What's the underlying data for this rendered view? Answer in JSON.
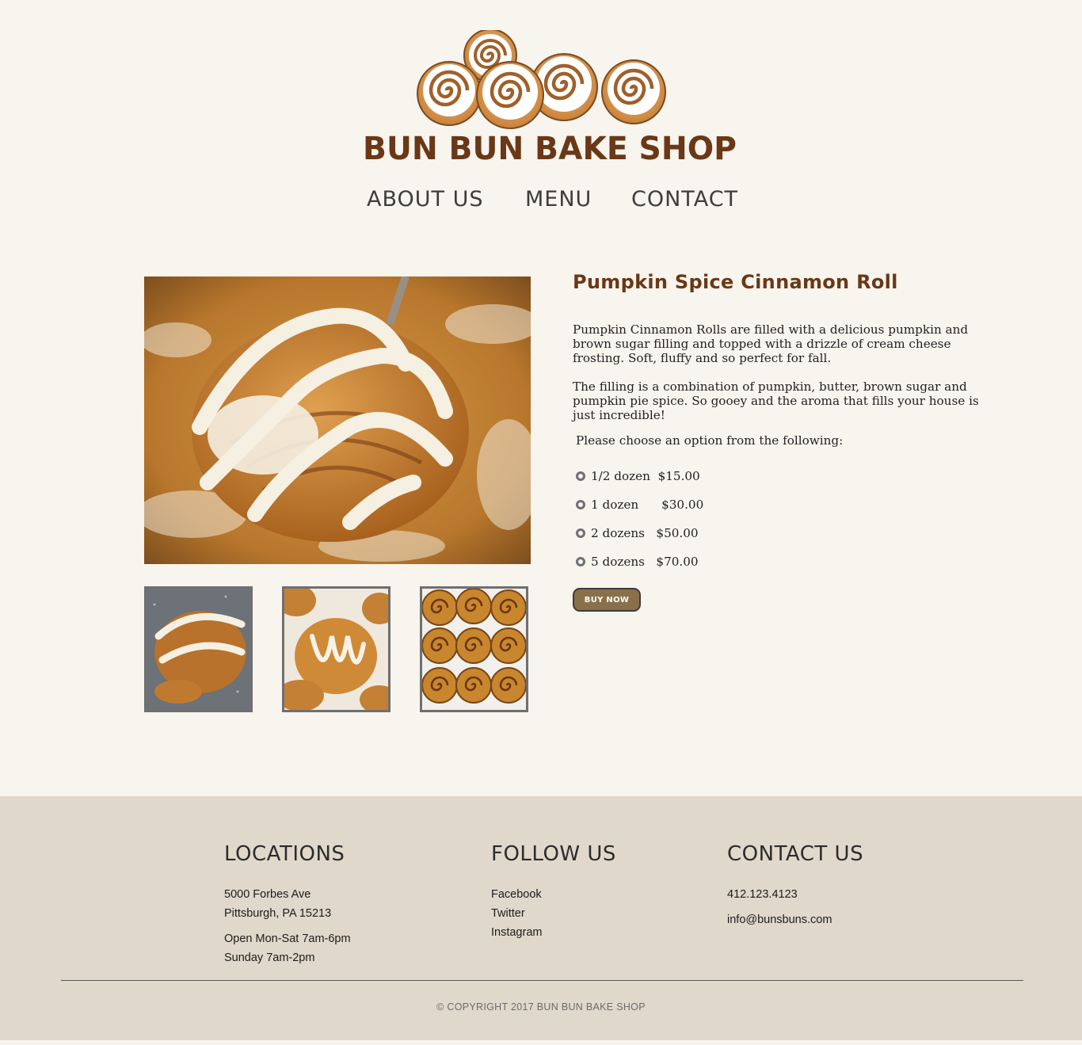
{
  "brand": {
    "name": "BUN BUN BAKE SHOP",
    "color": "#6a3817"
  },
  "nav": {
    "about": "ABOUT US",
    "menu": "MENU",
    "contact": "CONTACT"
  },
  "product": {
    "title": "Pumpkin Spice Cinnamon Roll",
    "description": [
      "Pumpkin Cinnamon Rolls are filled with a delicious pumpkin and brown sugar filling and topped with a drizzle of cream cheese frosting. Soft, fluffy and so perfect for fall.",
      "The filling is a combination of pumpkin, butter, brown sugar and pumpkin pie spice. So gooey and the aroma that fills your house is just incredible!"
    ],
    "choose_prompt": "Please choose an option from the following:",
    "options": [
      {
        "label": "1/2 dozen",
        "price": "$15.00"
      },
      {
        "label": "1 dozen",
        "price": "$30.00"
      },
      {
        "label": "2 dozens",
        "price": "$50.00"
      },
      {
        "label": "5 dozens",
        "price": "$70.00"
      }
    ],
    "buy_label": "BUY NOW",
    "hero_image": "pumpkin-cinnamon-roll-photo",
    "thumbnails": [
      "roll-on-plate-photo",
      "roll-with-fork-photo",
      "pan-of-rolls-photo"
    ]
  },
  "footer": {
    "locations": {
      "heading": "LOCATIONS",
      "address1": "5000 Forbes Ave",
      "address2": "Pittsburgh, PA 15213",
      "hours1": "Open Mon-Sat 7am-6pm",
      "hours2": "Sunday 7am-2pm"
    },
    "follow": {
      "heading": "FOLLOW US",
      "links": [
        "Facebook",
        "Twitter",
        "Instagram"
      ]
    },
    "contact": {
      "heading": "CONTACT US",
      "phone": "412.123.4123",
      "email": "info@bunsbuns.com"
    },
    "copyright": "© COPYRIGHT 2017 BUN BUN BAKE SHOP"
  },
  "colors": {
    "page_bg": "#f8f4ee",
    "footer_bg": "#e0d8cb",
    "button_bg": "#8a704a",
    "title_brown": "#6a3817"
  }
}
